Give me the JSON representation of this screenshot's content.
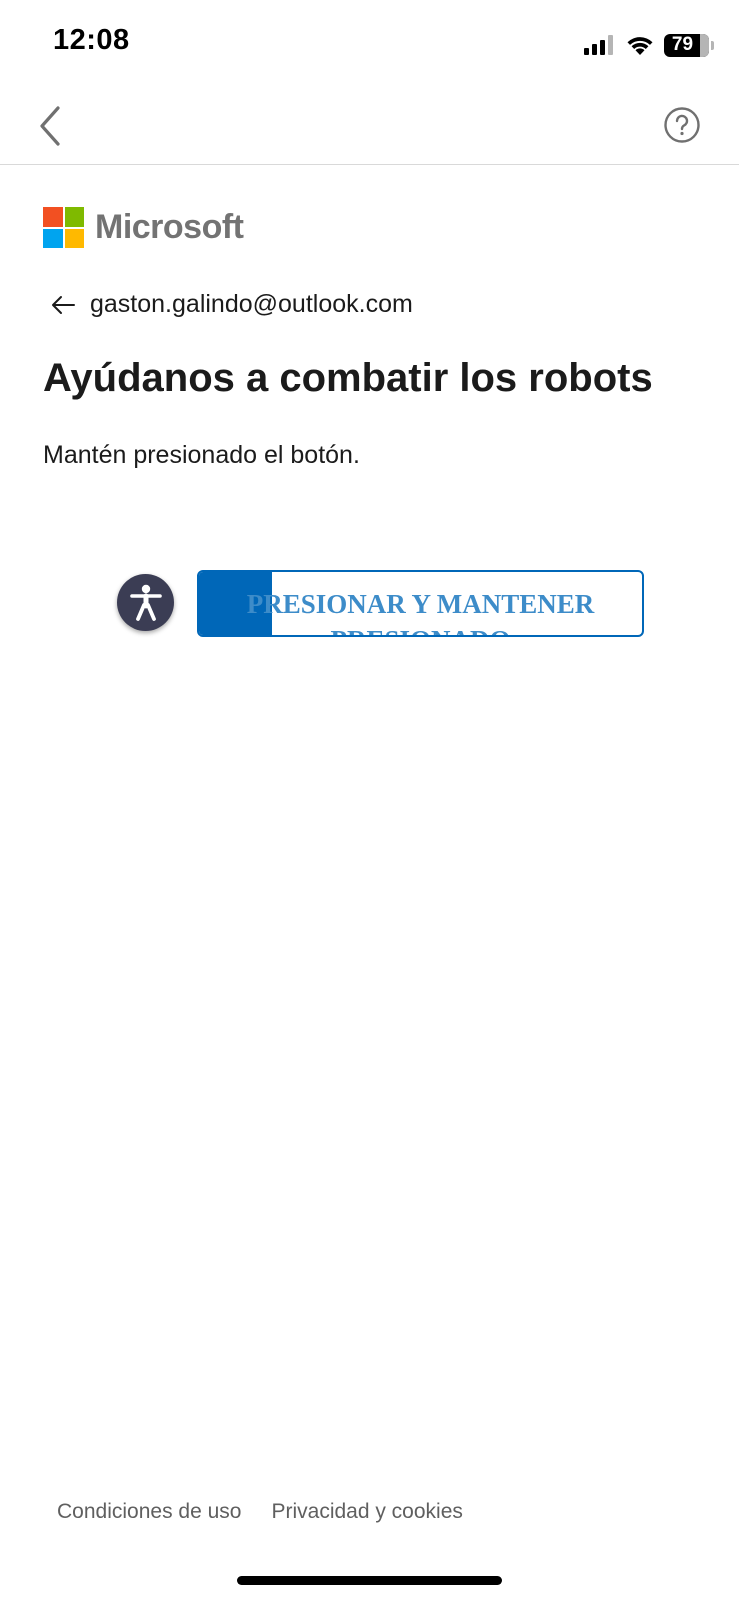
{
  "status_bar": {
    "time": "12:08",
    "battery": "79",
    "icons": [
      "signal-icon",
      "wifi-icon",
      "battery-icon"
    ]
  },
  "nav": {
    "back_icon": "chevron-left-icon",
    "help_icon": "question-circle-icon"
  },
  "brand": {
    "name": "Microsoft",
    "colors": {
      "red": "#f25022",
      "green": "#7fba00",
      "blue": "#00a4ef",
      "yellow": "#ffb900"
    }
  },
  "identity": {
    "back_icon": "arrow-left-icon",
    "email": "gaston.galindo@outlook.com"
  },
  "page": {
    "title": "Ayúdanos a combatir los robots",
    "instruction": "Mantén presionado el botón."
  },
  "challenge": {
    "accessibility_icon": "accessibility-person-icon",
    "button_label": "PRESIONAR Y MANTENER PRESIONADO",
    "progress_fraction": 0.165,
    "accent_color": "#0067b8"
  },
  "footer": {
    "terms": "Condiciones de uso",
    "privacy": "Privacidad y cookies"
  }
}
